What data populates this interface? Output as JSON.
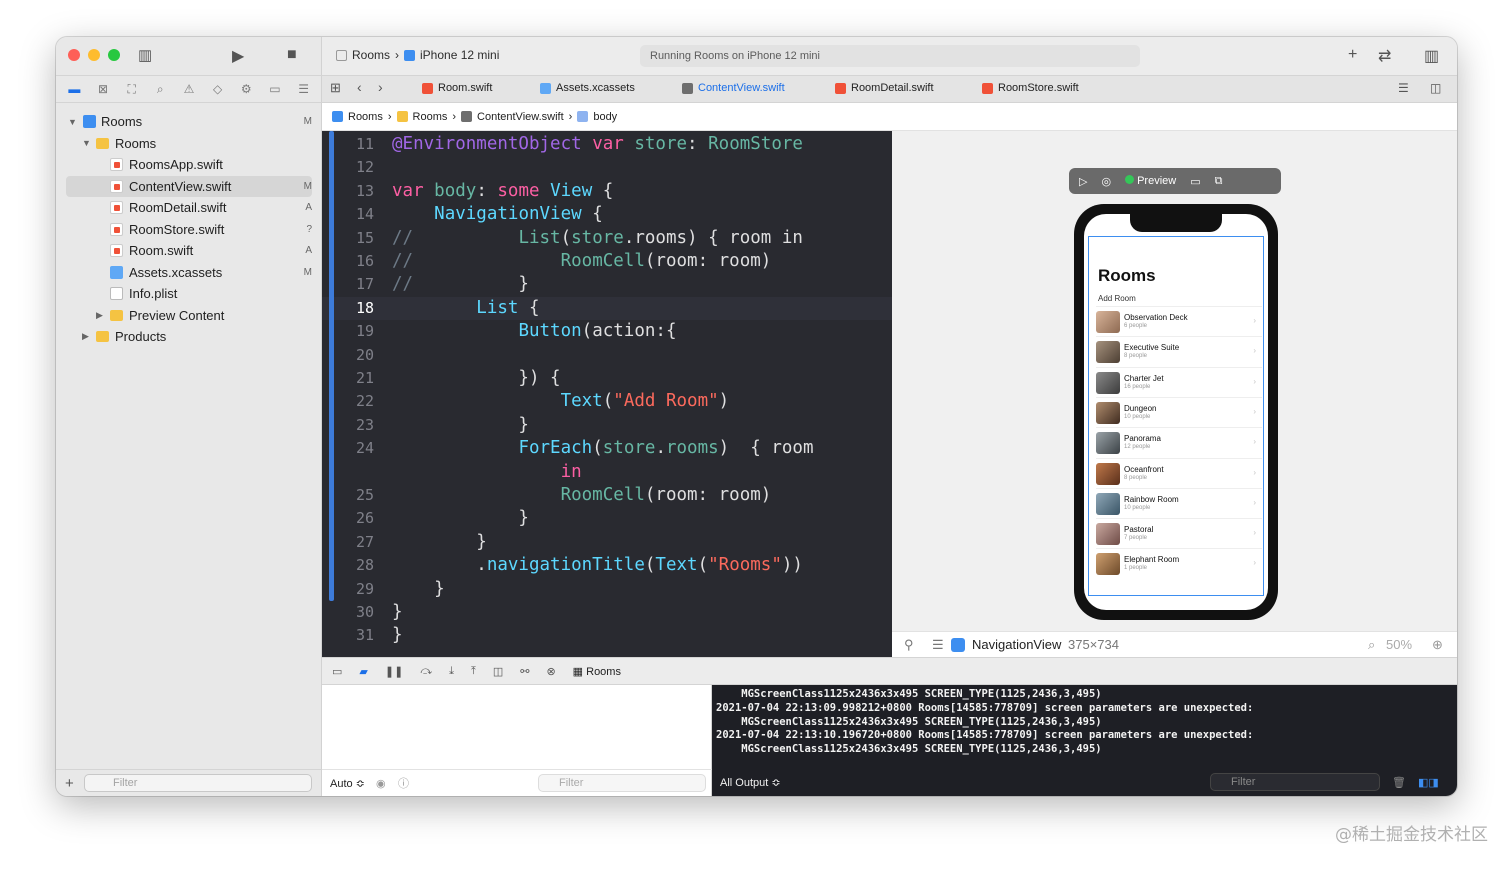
{
  "navigator": {
    "items": [
      {
        "label": "Rooms",
        "badge": "M"
      },
      {
        "label": "Rooms",
        "badge": ""
      },
      {
        "label": "RoomsApp.swift",
        "badge": ""
      },
      {
        "label": "ContentView.swift",
        "badge": "M"
      },
      {
        "label": "RoomDetail.swift",
        "badge": "A"
      },
      {
        "label": "RoomStore.swift",
        "badge": "?"
      },
      {
        "label": "Room.swift",
        "badge": "A"
      },
      {
        "label": "Assets.xcassets",
        "badge": "M"
      },
      {
        "label": "Info.plist",
        "badge": ""
      },
      {
        "label": "Preview Content",
        "badge": ""
      },
      {
        "label": "Products",
        "badge": ""
      }
    ],
    "filter_placeholder": "Filter"
  },
  "toolbar": {
    "scheme": "Rooms",
    "device": "iPhone 12 mini",
    "status": "Running Rooms on iPhone 12 mini"
  },
  "tabs": [
    "Room.swift",
    "Assets.xcassets",
    "ContentView.swift",
    "RoomDetail.swift",
    "RoomStore.swift"
  ],
  "breadcrumb": [
    "Rooms",
    "Rooms",
    "ContentView.swift",
    "body"
  ],
  "code_lines": [
    {
      "num": "11",
      "code": "@EnvironmentObject var store: RoomStore"
    },
    {
      "num": "12",
      "code": ""
    },
    {
      "num": "13",
      "code": "var body: some View {"
    },
    {
      "num": "14",
      "code": "    NavigationView {"
    },
    {
      "num": "15",
      "code": "//          List(store.rooms) { room in"
    },
    {
      "num": "16",
      "code": "//              RoomCell(room: room)"
    },
    {
      "num": "17",
      "code": "//          }"
    },
    {
      "num": "18",
      "code": "        List {"
    },
    {
      "num": "19",
      "code": "            Button(action:{"
    },
    {
      "num": "20",
      "code": ""
    },
    {
      "num": "21",
      "code": "            }) {"
    },
    {
      "num": "22",
      "code": "                Text(\"Add Room\")"
    },
    {
      "num": "23",
      "code": "            }"
    },
    {
      "num": "24",
      "code": "            ForEach(store.rooms)  { room"
    },
    {
      "num": "",
      "code": "                in"
    },
    {
      "num": "25",
      "code": "                RoomCell(room: room)"
    },
    {
      "num": "26",
      "code": "            }"
    },
    {
      "num": "27",
      "code": "        }"
    },
    {
      "num": "28",
      "code": "        .navigationTitle(Text(\"Rooms\"))"
    },
    {
      "num": "29",
      "code": "    }"
    },
    {
      "num": "30",
      "code": "}"
    },
    {
      "num": "31",
      "code": "}"
    }
  ],
  "preview": {
    "label": "Preview",
    "app_title": "Rooms",
    "add_label": "Add Room",
    "rooms": [
      {
        "name": "Observation Deck",
        "people": "6 people"
      },
      {
        "name": "Executive Suite",
        "people": "8 people"
      },
      {
        "name": "Charter Jet",
        "people": "16 people"
      },
      {
        "name": "Dungeon",
        "people": "10 people"
      },
      {
        "name": "Panorama",
        "people": "12 people"
      },
      {
        "name": "Oceanfront",
        "people": "8 people"
      },
      {
        "name": "Rainbow Room",
        "people": "10 people"
      },
      {
        "name": "Pastoral",
        "people": "7 people"
      },
      {
        "name": "Elephant Room",
        "people": "1 people"
      }
    ],
    "inspector_label": "NavigationView",
    "inspector_size": "375×734",
    "zoom": "50%"
  },
  "debug": {
    "target": "Rooms",
    "auto_label": "Auto ≎",
    "filter_placeholder": "Filter",
    "output_label": "All Output ≎"
  },
  "console_lines": [
    "    MGScreenClass1125x2436x3x495 SCREEN_TYPE(1125,2436,3,495)",
    "2021-07-04 22:13:09.998212+0800 Rooms[14585:778709] screen parameters are unexpected:",
    "    MGScreenClass1125x2436x3x495 SCREEN_TYPE(1125,2436,3,495)",
    "2021-07-04 22:13:10.196720+0800 Rooms[14585:778709] screen parameters are unexpected:",
    "    MGScreenClass1125x2436x3x495 SCREEN_TYPE(1125,2436,3,495)"
  ],
  "watermark": "@稀土掘金技术社区",
  "colors": {
    "accent": "#1c6fe8",
    "editor_bg": "#292a30",
    "keyword": "#fc5fa3",
    "type": "#5dd8ff",
    "string": "#fc6a5d"
  }
}
